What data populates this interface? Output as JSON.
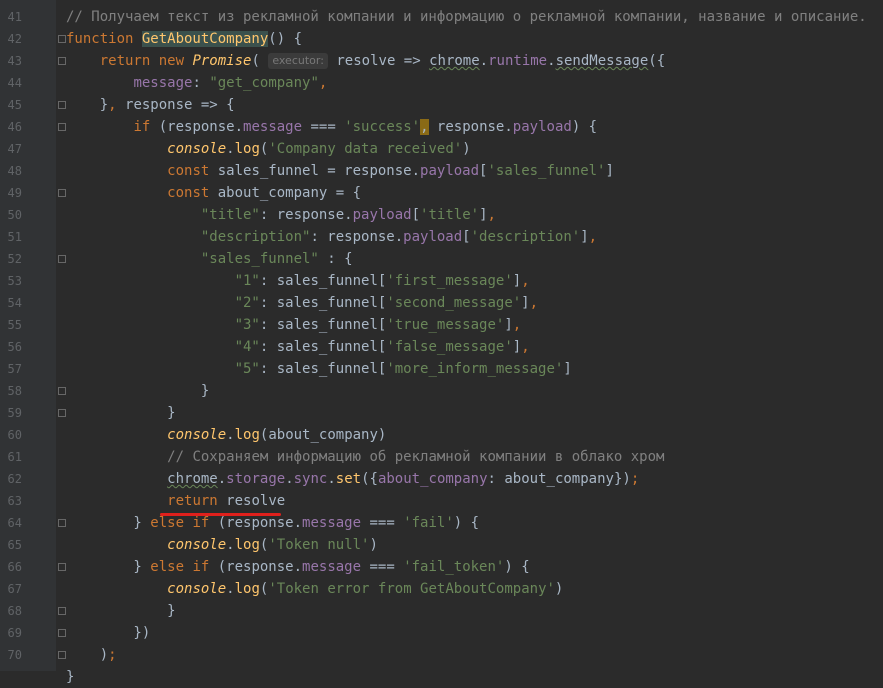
{
  "lines": [
    {
      "n": "41",
      "parts": [
        {
          "c": "com",
          "t": "// Получаем текст из рекламной компании и информацию о рекламной компании, название и описание."
        }
      ]
    },
    {
      "n": "42",
      "parts": [
        {
          "c": "kw",
          "t": "function "
        },
        {
          "c": "hlfn",
          "t": "GetAboutCompany"
        },
        {
          "c": "plain",
          "t": "() {"
        }
      ]
    },
    {
      "n": "43",
      "parts": [
        {
          "c": "plain",
          "t": "    "
        },
        {
          "c": "kw",
          "t": "return new "
        },
        {
          "c": "it",
          "t": "Promise"
        },
        {
          "c": "plain",
          "t": "( "
        },
        {
          "c": "hint",
          "t": "executor:"
        },
        {
          "c": "plain",
          "t": " resolve => "
        },
        {
          "c": "squig",
          "t": "chrome"
        },
        {
          "c": "plain",
          "t": "."
        },
        {
          "c": "prop",
          "t": "runtime"
        },
        {
          "c": "plain",
          "t": "."
        },
        {
          "c": "squig",
          "t": "sendMessage"
        },
        {
          "c": "plain",
          "t": "({"
        }
      ]
    },
    {
      "n": "44",
      "parts": [
        {
          "c": "plain",
          "t": "        "
        },
        {
          "c": "prop",
          "t": "message"
        },
        {
          "c": "plain",
          "t": ": "
        },
        {
          "c": "str",
          "t": "\"get_company\""
        },
        {
          "c": "kw",
          "t": ","
        }
      ]
    },
    {
      "n": "45",
      "parts": [
        {
          "c": "plain",
          "t": "    }"
        },
        {
          "c": "kw",
          "t": ","
        },
        {
          "c": "plain",
          "t": " response => {"
        }
      ]
    },
    {
      "n": "46",
      "parts": [
        {
          "c": "plain",
          "t": "        "
        },
        {
          "c": "kw",
          "t": "if "
        },
        {
          "c": "plain",
          "t": "(response."
        },
        {
          "c": "prop",
          "t": "message"
        },
        {
          "c": "plain",
          "t": " === "
        },
        {
          "c": "str",
          "t": "'success'"
        },
        {
          "c": "caretbox",
          "t": ","
        },
        {
          "c": "plain",
          "t": " response."
        },
        {
          "c": "prop",
          "t": "payload"
        },
        {
          "c": "plain",
          "t": ") {"
        }
      ]
    },
    {
      "n": "47",
      "parts": [
        {
          "c": "plain",
          "t": "            "
        },
        {
          "c": "it",
          "t": "console"
        },
        {
          "c": "plain",
          "t": "."
        },
        {
          "c": "fn",
          "t": "log"
        },
        {
          "c": "plain",
          "t": "("
        },
        {
          "c": "str",
          "t": "'Company data received'"
        },
        {
          "c": "plain",
          "t": ")"
        }
      ]
    },
    {
      "n": "48",
      "parts": [
        {
          "c": "plain",
          "t": "            "
        },
        {
          "c": "kw",
          "t": "const "
        },
        {
          "c": "plain",
          "t": "sales_funnel = response."
        },
        {
          "c": "prop",
          "t": "payload"
        },
        {
          "c": "plain",
          "t": "["
        },
        {
          "c": "str",
          "t": "'sales_funnel'"
        },
        {
          "c": "plain",
          "t": "]"
        }
      ]
    },
    {
      "n": "49",
      "parts": [
        {
          "c": "plain",
          "t": "            "
        },
        {
          "c": "kw",
          "t": "const "
        },
        {
          "c": "plain",
          "t": "about_company = {"
        }
      ]
    },
    {
      "n": "50",
      "parts": [
        {
          "c": "plain",
          "t": "                "
        },
        {
          "c": "str",
          "t": "\"title\""
        },
        {
          "c": "plain",
          "t": ": response."
        },
        {
          "c": "prop",
          "t": "payload"
        },
        {
          "c": "plain",
          "t": "["
        },
        {
          "c": "str",
          "t": "'title'"
        },
        {
          "c": "plain",
          "t": "]"
        },
        {
          "c": "kw",
          "t": ","
        }
      ]
    },
    {
      "n": "51",
      "parts": [
        {
          "c": "plain",
          "t": "                "
        },
        {
          "c": "str",
          "t": "\"description\""
        },
        {
          "c": "plain",
          "t": ": response."
        },
        {
          "c": "prop",
          "t": "payload"
        },
        {
          "c": "plain",
          "t": "["
        },
        {
          "c": "str",
          "t": "'description'"
        },
        {
          "c": "plain",
          "t": "]"
        },
        {
          "c": "kw",
          "t": ","
        }
      ]
    },
    {
      "n": "52",
      "parts": [
        {
          "c": "plain",
          "t": "                "
        },
        {
          "c": "str",
          "t": "\"sales_funnel\""
        },
        {
          "c": "plain",
          "t": " : {"
        }
      ]
    },
    {
      "n": "53",
      "parts": [
        {
          "c": "plain",
          "t": "                    "
        },
        {
          "c": "str",
          "t": "\"1\""
        },
        {
          "c": "plain",
          "t": ": sales_funnel["
        },
        {
          "c": "str",
          "t": "'first_message'"
        },
        {
          "c": "plain",
          "t": "]"
        },
        {
          "c": "kw",
          "t": ","
        }
      ]
    },
    {
      "n": "54",
      "parts": [
        {
          "c": "plain",
          "t": "                    "
        },
        {
          "c": "str",
          "t": "\"2\""
        },
        {
          "c": "plain",
          "t": ": sales_funnel["
        },
        {
          "c": "str",
          "t": "'second_message'"
        },
        {
          "c": "plain",
          "t": "]"
        },
        {
          "c": "kw",
          "t": ","
        }
      ]
    },
    {
      "n": "55",
      "parts": [
        {
          "c": "plain",
          "t": "                    "
        },
        {
          "c": "str",
          "t": "\"3\""
        },
        {
          "c": "plain",
          "t": ": sales_funnel["
        },
        {
          "c": "str",
          "t": "'true_message'"
        },
        {
          "c": "plain",
          "t": "]"
        },
        {
          "c": "kw",
          "t": ","
        }
      ]
    },
    {
      "n": "56",
      "parts": [
        {
          "c": "plain",
          "t": "                    "
        },
        {
          "c": "str",
          "t": "\"4\""
        },
        {
          "c": "plain",
          "t": ": sales_funnel["
        },
        {
          "c": "str",
          "t": "'false_message'"
        },
        {
          "c": "plain",
          "t": "]"
        },
        {
          "c": "kw",
          "t": ","
        }
      ]
    },
    {
      "n": "57",
      "parts": [
        {
          "c": "plain",
          "t": "                    "
        },
        {
          "c": "str",
          "t": "\"5\""
        },
        {
          "c": "plain",
          "t": ": sales_funnel["
        },
        {
          "c": "str",
          "t": "'more_inform_message'"
        },
        {
          "c": "plain",
          "t": "]"
        }
      ]
    },
    {
      "n": "58",
      "parts": [
        {
          "c": "plain",
          "t": "                }"
        }
      ]
    },
    {
      "n": "59",
      "parts": [
        {
          "c": "plain",
          "t": "            }"
        }
      ]
    },
    {
      "n": "60",
      "parts": [
        {
          "c": "plain",
          "t": "            "
        },
        {
          "c": "it",
          "t": "console"
        },
        {
          "c": "plain",
          "t": "."
        },
        {
          "c": "fn",
          "t": "log"
        },
        {
          "c": "plain",
          "t": "(about_company)"
        }
      ]
    },
    {
      "n": "61",
      "parts": [
        {
          "c": "plain",
          "t": "            "
        },
        {
          "c": "com",
          "t": "// Сохраняем информацию об рекламной компании в облако хром"
        }
      ]
    },
    {
      "n": "62",
      "parts": [
        {
          "c": "plain",
          "t": "            "
        },
        {
          "c": "squig",
          "t": "chrome"
        },
        {
          "c": "plain",
          "t": "."
        },
        {
          "c": "prop",
          "t": "storage"
        },
        {
          "c": "plain",
          "t": "."
        },
        {
          "c": "prop",
          "t": "sync"
        },
        {
          "c": "plain",
          "t": "."
        },
        {
          "c": "fn",
          "t": "set"
        },
        {
          "c": "plain",
          "t": "({"
        },
        {
          "c": "prop",
          "t": "about_company"
        },
        {
          "c": "plain",
          "t": ": about_company})"
        },
        {
          "c": "kw",
          "t": ";"
        }
      ]
    },
    {
      "n": "63",
      "parts": [
        {
          "c": "plain",
          "t": "            "
        },
        {
          "c": "kw",
          "t": "return "
        },
        {
          "c": "plain",
          "t": "resolve"
        }
      ]
    },
    {
      "n": "64",
      "parts": [
        {
          "c": "plain",
          "t": "        } "
        },
        {
          "c": "kw",
          "t": "else if "
        },
        {
          "c": "plain",
          "t": "(response."
        },
        {
          "c": "prop",
          "t": "message"
        },
        {
          "c": "plain",
          "t": " === "
        },
        {
          "c": "str",
          "t": "'fail'"
        },
        {
          "c": "plain",
          "t": ") {"
        }
      ]
    },
    {
      "n": "65",
      "parts": [
        {
          "c": "plain",
          "t": "            "
        },
        {
          "c": "it",
          "t": "console"
        },
        {
          "c": "plain",
          "t": "."
        },
        {
          "c": "fn",
          "t": "log"
        },
        {
          "c": "plain",
          "t": "("
        },
        {
          "c": "str",
          "t": "'Token null'"
        },
        {
          "c": "plain",
          "t": ")"
        }
      ]
    },
    {
      "n": "66",
      "parts": [
        {
          "c": "plain",
          "t": "        } "
        },
        {
          "c": "kw",
          "t": "else if "
        },
        {
          "c": "plain",
          "t": "(response."
        },
        {
          "c": "prop",
          "t": "message"
        },
        {
          "c": "plain",
          "t": " === "
        },
        {
          "c": "str",
          "t": "'fail_token'"
        },
        {
          "c": "plain",
          "t": ") {"
        }
      ]
    },
    {
      "n": "67",
      "parts": [
        {
          "c": "plain",
          "t": "            "
        },
        {
          "c": "it",
          "t": "console"
        },
        {
          "c": "plain",
          "t": "."
        },
        {
          "c": "fn",
          "t": "log"
        },
        {
          "c": "plain",
          "t": "("
        },
        {
          "c": "str",
          "t": "'Token error from GetAboutCompany'"
        },
        {
          "c": "plain",
          "t": ")"
        }
      ]
    },
    {
      "n": "68",
      "parts": [
        {
          "c": "plain",
          "t": "            }"
        }
      ]
    },
    {
      "n": "69",
      "parts": [
        {
          "c": "plain",
          "t": "        })"
        }
      ]
    },
    {
      "n": "70",
      "parts": [
        {
          "c": "plain",
          "t": "    )"
        },
        {
          "c": "kw",
          "t": ";"
        }
      ]
    },
    {
      "n": "",
      "parts": [
        {
          "c": "plain",
          "t": "}"
        }
      ]
    }
  ],
  "colors": {
    "background": "#2b2b2b",
    "gutter": "#313335",
    "annotation": "#e0201c"
  }
}
